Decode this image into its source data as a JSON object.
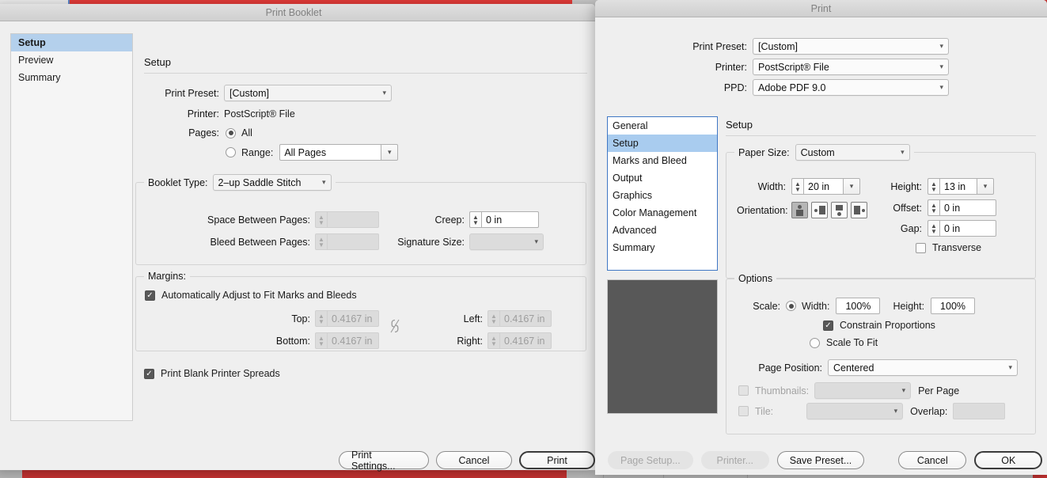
{
  "background": {
    "accent_red": "#e23b38",
    "desk_grey": "#c9c9c9"
  },
  "print_booklet": {
    "title": "Print Booklet",
    "sidebar": {
      "items": [
        {
          "label": "Setup",
          "selected": true
        },
        {
          "label": "Preview",
          "selected": false
        },
        {
          "label": "Summary",
          "selected": false
        }
      ]
    },
    "panel_title": "Setup",
    "print_preset": {
      "label": "Print Preset:",
      "value": "[Custom]"
    },
    "printer": {
      "label": "Printer:",
      "value": "PostScript® File"
    },
    "pages": {
      "label": "Pages:",
      "all_label": "All",
      "all_selected": true,
      "range_label": "Range:",
      "range_selected": false,
      "range_value": "All Pages"
    },
    "booklet_group": {
      "legend": "Booklet Type:",
      "type_value": "2–up Saddle Stitch",
      "space_between_label": "Space Between Pages:",
      "space_between_value": "",
      "bleed_between_label": "Bleed Between Pages:",
      "bleed_between_value": "",
      "creep_label": "Creep:",
      "creep_value": "0 in",
      "signature_label": "Signature Size:",
      "signature_value": ""
    },
    "margins_group": {
      "legend": "Margins:",
      "auto_adjust_label": "Automatically Adjust to Fit Marks and Bleeds",
      "auto_adjust_checked": true,
      "top_label": "Top:",
      "top_value": "0.4167 in",
      "bottom_label": "Bottom:",
      "bottom_value": "0.4167 in",
      "left_label": "Left:",
      "left_value": "0.4167 in",
      "right_label": "Right:",
      "right_value": "0.4167 in",
      "link_icon": "broken-chain-icon"
    },
    "blank_spreads": {
      "label": "Print Blank Printer Spreads",
      "checked": true
    },
    "buttons": {
      "print_settings": "Print Settings...",
      "cancel": "Cancel",
      "print": "Print"
    }
  },
  "print_dialog": {
    "title": "Print",
    "print_preset": {
      "label": "Print Preset:",
      "value": "[Custom]"
    },
    "printer": {
      "label": "Printer:",
      "value": "PostScript® File"
    },
    "ppd": {
      "label": "PPD:",
      "value": "Adobe PDF 9.0"
    },
    "categories": [
      {
        "label": "General",
        "selected": false
      },
      {
        "label": "Setup",
        "selected": true
      },
      {
        "label": "Marks and Bleed",
        "selected": false
      },
      {
        "label": "Output",
        "selected": false
      },
      {
        "label": "Graphics",
        "selected": false
      },
      {
        "label": "Color Management",
        "selected": false
      },
      {
        "label": "Advanced",
        "selected": false
      },
      {
        "label": "Summary",
        "selected": false
      }
    ],
    "section_title": "Setup",
    "setup_group": {
      "paper_size_label": "Paper Size:",
      "paper_size_value": "Custom",
      "width_label": "Width:",
      "width_value": "20 in",
      "height_label": "Height:",
      "height_value": "13 in",
      "orientation_label": "Orientation:",
      "orientation_selected_index": 0,
      "offset_label": "Offset:",
      "offset_value": "0 in",
      "gap_label": "Gap:",
      "gap_value": "0 in",
      "transverse_label": "Transverse",
      "transverse_checked": false
    },
    "options_group": {
      "legend": "Options",
      "scale_label": "Scale:",
      "scale_width_label": "Width:",
      "scale_width_value": "100%",
      "scale_height_label": "Height:",
      "scale_height_value": "100%",
      "scale_radio_selected": true,
      "constrain_label": "Constrain Proportions",
      "constrain_checked": true,
      "scale_to_fit_label": "Scale To Fit",
      "scale_to_fit_selected": false,
      "page_position_label": "Page Position:",
      "page_position_value": "Centered",
      "thumbnails_label": "Thumbnails:",
      "thumbnails_checked": false,
      "thumbnails_value": "",
      "per_page_label": "Per Page",
      "tile_label": "Tile:",
      "tile_checked": false,
      "tile_value": "",
      "overlap_label": "Overlap:",
      "overlap_value": ""
    },
    "buttons": {
      "page_setup": "Page Setup...",
      "printer": "Printer...",
      "save_preset": "Save Preset...",
      "cancel": "Cancel",
      "ok": "OK"
    }
  }
}
